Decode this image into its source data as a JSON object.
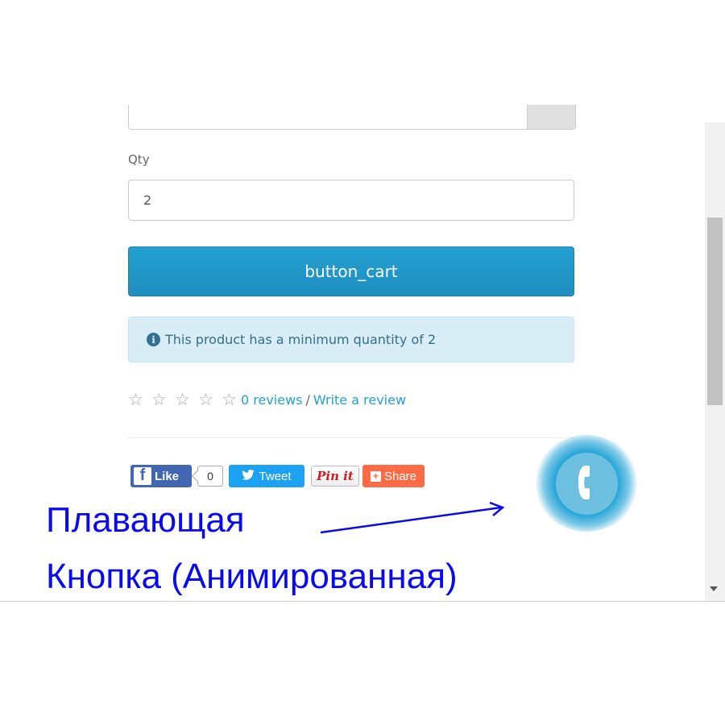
{
  "form": {
    "qty_label": "Qty",
    "qty_value": "2",
    "cart_button_label": "button_cart",
    "min_qty_alert": "This product has a minimum quantity of 2"
  },
  "rating": {
    "stars_filled": 0,
    "stars_total": 5,
    "reviews_link": "0 reviews",
    "separator": "/",
    "write_review_link": "Write a review"
  },
  "social": {
    "like_label": "Like",
    "like_count": "0",
    "tweet_label": "Tweet",
    "pin_label": "Pin it",
    "share_label": "Share"
  },
  "floating_button": {
    "icon": "phone-icon",
    "color": "#2aa7d8"
  },
  "caption": {
    "line1": "Плавающая",
    "line2": "Кнопка (Анимированная)",
    "color": "#0a0af0"
  },
  "colors": {
    "cart_button": "#1f8dc0",
    "alert_bg": "#d9edf7",
    "alert_text": "#31708f",
    "link": "#23a1d1",
    "facebook": "#4267b2",
    "twitter": "#1da1f2",
    "pinterest": "#cb2027",
    "share": "#fd6a46"
  }
}
